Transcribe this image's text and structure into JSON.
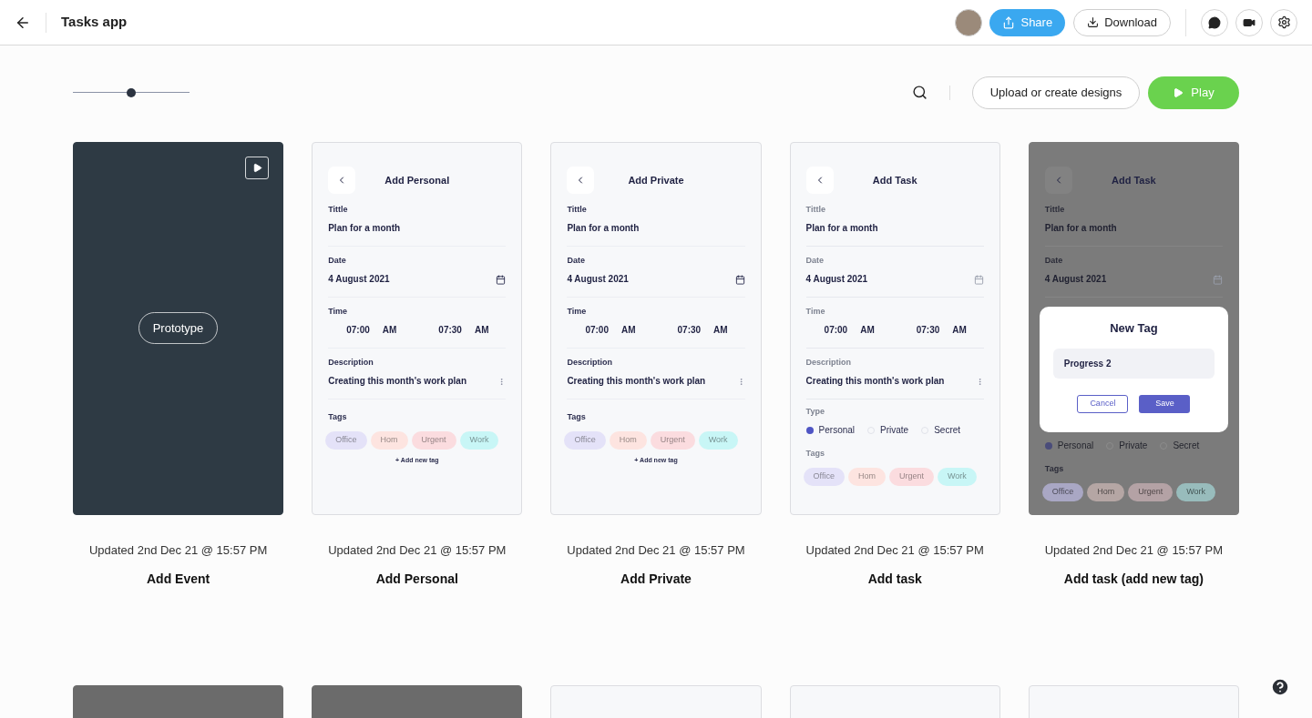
{
  "header": {
    "title": "Tasks app",
    "buttons": [
      {
        "label": "Share",
        "kind": "primary"
      },
      {
        "label": "Download",
        "kind": "secondary"
      }
    ]
  },
  "toolbar": {
    "zoom": {
      "level": 0.5
    },
    "buttons": [
      {
        "label": "Upload or create designs",
        "kind": "outline"
      },
      {
        "label": "Play",
        "kind": "play"
      }
    ]
  },
  "screens": [
    {
      "name": "Add Event",
      "updated": "Updated 2nd Dec 21 @ 15:57 PM",
      "preview": {
        "overlay_button": "Prototype"
      }
    },
    {
      "name": "Add Personal",
      "updated": "Updated 2nd Dec 21 @ 15:57 PM",
      "preview": {
        "title": "Add Personal",
        "fields": [
          {
            "kind": "text",
            "label": "Tittle",
            "value": "Plan for a month"
          },
          {
            "kind": "date",
            "label": "Date",
            "value": "4 August 2021"
          },
          {
            "kind": "time",
            "label": "Time",
            "times": [
              {
                "time": "07:00",
                "period": "AM"
              },
              {
                "time": "07:30",
                "period": "AM"
              }
            ]
          },
          {
            "kind": "description",
            "label": "Description",
            "value": "Creating this month's work plan"
          },
          {
            "kind": "tags",
            "label": "Tags",
            "add_label": "+ Add new tag",
            "tags": [
              {
                "label": "Office",
                "color": "#e4e2f8"
              },
              {
                "label": "Hom",
                "color": "#fde4e0"
              },
              {
                "label": "Urgent",
                "color": "#fbdcdf"
              },
              {
                "label": "Work",
                "color": "#c8f6f6"
              }
            ]
          }
        ]
      }
    },
    {
      "name": "Add Private",
      "updated": "Updated 2nd Dec 21 @ 15:57 PM",
      "preview": {
        "title": "Add Private",
        "fields": [
          {
            "kind": "text",
            "label": "Tittle",
            "value": "Plan for a month"
          },
          {
            "kind": "date",
            "label": "Date",
            "value": "4 August 2021"
          },
          {
            "kind": "time",
            "label": "Time",
            "times": [
              {
                "time": "07:00",
                "period": "AM"
              },
              {
                "time": "07:30",
                "period": "AM"
              }
            ]
          },
          {
            "kind": "description",
            "label": "Description",
            "value": "Creating this month's work plan"
          },
          {
            "kind": "tags",
            "label": "Tags",
            "add_label": "+ Add new tag",
            "tags": [
              {
                "label": "Office",
                "color": "#e4e2f8"
              },
              {
                "label": "Hom",
                "color": "#fde4e0"
              },
              {
                "label": "Urgent",
                "color": "#fbdcdf"
              },
              {
                "label": "Work",
                "color": "#c8f6f6"
              }
            ]
          }
        ]
      }
    },
    {
      "name": "Add task",
      "updated": "Updated 2nd Dec 21 @ 15:57 PM",
      "preview": {
        "title": "Add Task",
        "fields": [
          {
            "kind": "text",
            "label": "Tittle",
            "value": "Plan for a month"
          },
          {
            "kind": "date",
            "label": "Date",
            "value": "4 August 2021"
          },
          {
            "kind": "time",
            "label": "Time",
            "times": [
              {
                "time": "07:00",
                "period": "AM"
              },
              {
                "time": "07:30",
                "period": "AM"
              }
            ]
          },
          {
            "kind": "description",
            "label": "Description",
            "value": "Creating this month's work plan"
          },
          {
            "kind": "type",
            "label": "Type",
            "options": [
              {
                "label": "Personal",
                "selected": true
              },
              {
                "label": "Private",
                "selected": false
              },
              {
                "label": "Secret",
                "selected": false
              }
            ]
          },
          {
            "kind": "tags",
            "label": "Tags",
            "tags": [
              {
                "label": "Office",
                "color": "#e4e2f8"
              },
              {
                "label": "Hom",
                "color": "#fde4e0"
              },
              {
                "label": "Urgent",
                "color": "#fbdcdf"
              },
              {
                "label": "Work",
                "color": "#c8f6f6"
              }
            ]
          }
        ]
      }
    },
    {
      "name": "Add task (add new tag)",
      "updated": "Updated 2nd Dec 21 @ 15:57 PM",
      "preview": {
        "title": "Add Task",
        "fields": [
          {
            "kind": "text",
            "label": "Tittle",
            "value": "Plan for a month"
          },
          {
            "kind": "date",
            "label": "Date",
            "value": "4 August 2021"
          },
          {
            "kind": "dialog",
            "title": "New Tag",
            "value": "Progress 2",
            "buttons": [
              "Cancel",
              "Save"
            ]
          },
          {
            "kind": "type",
            "options": [
              {
                "label": "Personal",
                "selected": true
              },
              {
                "label": "Private",
                "selected": false
              },
              {
                "label": "Secret",
                "selected": false
              }
            ]
          },
          {
            "kind": "tags",
            "label": "Tags",
            "tags": [
              {
                "label": "Office",
                "color": "#a9a7c4"
              },
              {
                "label": "Hom",
                "color": "#b5a6a4"
              },
              {
                "label": "Urgent",
                "color": "#b4a2a5"
              },
              {
                "label": "Work",
                "color": "#98bcbc"
              }
            ]
          }
        ]
      }
    }
  ],
  "next_row": [
    {
      "dimmed": true
    },
    {
      "dimmed": true
    },
    {
      "dimmed": false
    },
    {
      "dimmed": false
    },
    {
      "dimmed": false
    }
  ]
}
